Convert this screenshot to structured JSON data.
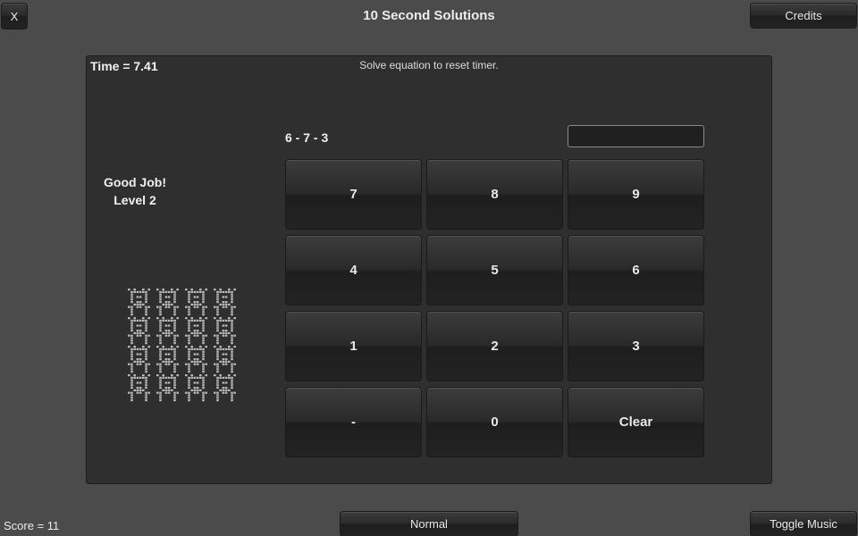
{
  "header": {
    "close_label": "X",
    "title": "10 Second Solutions",
    "credits_label": "Credits"
  },
  "game": {
    "timer_text": "Time = 7.41",
    "hint": "Solve equation to reset timer.",
    "status_line1": "Good Job!",
    "status_line2": "Level 2",
    "equation": "6 - 7 - 3",
    "answer_value": "",
    "keypad": [
      {
        "label": "7",
        "name": "key-7-button"
      },
      {
        "label": "8",
        "name": "key-8-button"
      },
      {
        "label": "9",
        "name": "key-9-button"
      },
      {
        "label": "4",
        "name": "key-4-button"
      },
      {
        "label": "5",
        "name": "key-5-button"
      },
      {
        "label": "6",
        "name": "key-6-button"
      },
      {
        "label": "1",
        "name": "key-1-button"
      },
      {
        "label": "2",
        "name": "key-2-button"
      },
      {
        "label": "3",
        "name": "key-3-button"
      },
      {
        "label": "-",
        "name": "key-minus-button"
      },
      {
        "label": "0",
        "name": "key-0-button"
      },
      {
        "label": "Clear",
        "name": "clear-button"
      }
    ],
    "sprite_count": 16,
    "sprite_icon": "pixel-creature-icon",
    "sprite_color": "#b8b8b8"
  },
  "footer": {
    "score_text": "Score = 11",
    "difficulty_label": "Normal",
    "music_label": "Toggle Music"
  }
}
